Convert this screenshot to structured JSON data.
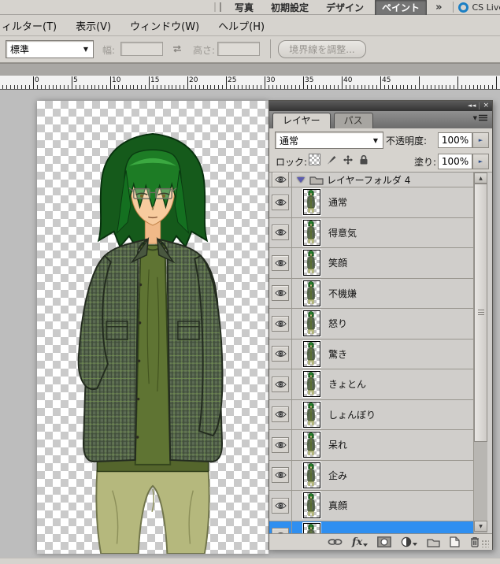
{
  "app_bar": {
    "workspaces": [
      {
        "label": "写真",
        "active": false
      },
      {
        "label": "初期設定",
        "active": false
      },
      {
        "label": "デザイン",
        "active": false
      },
      {
        "label": "ペイント",
        "active": true
      }
    ],
    "overflow_label": "»",
    "cs_live_label": "CS Live"
  },
  "menu_bar": {
    "items": [
      "ィルター(T)",
      "表示(V)",
      "ウィンドウ(W)",
      "ヘルプ(H)"
    ]
  },
  "options_bar": {
    "mode_value": "標準",
    "width_label": "幅:",
    "width_value": "",
    "height_label": "高さ:",
    "height_value": "",
    "refine_edge_label": "境界線を調整..."
  },
  "ruler": {
    "labels": [
      0,
      5,
      10,
      15,
      20,
      25,
      30,
      35,
      40,
      45
    ]
  },
  "layers_panel": {
    "tabs": [
      {
        "label": "レイヤー",
        "active": true
      },
      {
        "label": "パス",
        "active": false
      }
    ],
    "blend_mode_value": "通常",
    "opacity_label": "不透明度:",
    "opacity_value": "100%",
    "lock_label": "ロック:",
    "fill_label": "塗り:",
    "fill_value": "100%",
    "folder": {
      "name": "レイヤーフォルダ 4",
      "expanded": true
    },
    "layers": [
      {
        "name": "通常",
        "selected": false
      },
      {
        "name": "得意気",
        "selected": false
      },
      {
        "name": "笑顔",
        "selected": false
      },
      {
        "name": "不機嫌",
        "selected": false
      },
      {
        "name": "怒り",
        "selected": false
      },
      {
        "name": "驚き",
        "selected": false
      },
      {
        "name": "きょとん",
        "selected": false
      },
      {
        "name": "しょんぼり",
        "selected": false
      },
      {
        "name": "呆れ",
        "selected": false
      },
      {
        "name": "企み",
        "selected": false
      },
      {
        "name": "真顔",
        "selected": false
      },
      {
        "name": "",
        "selected": true
      }
    ],
    "toolbar": {
      "fx_label": "fx"
    }
  },
  "colors": {
    "selection_blue": "#2f8ff0",
    "cs_live_blue": "#1b7fc4",
    "panel_bg": "#d6d3ce"
  }
}
